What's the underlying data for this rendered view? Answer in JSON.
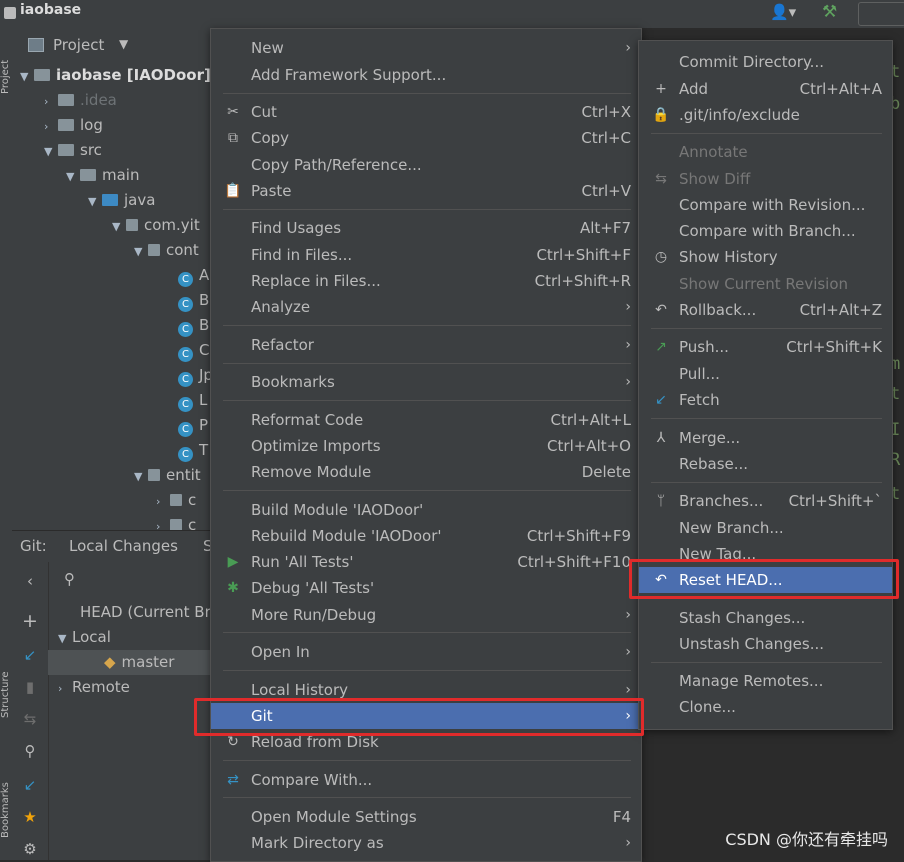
{
  "window": {
    "title": "iaobase"
  },
  "stripe": {
    "project_label": "Project",
    "structure_label": "Structure",
    "bookmarks_label": "Bookmarks"
  },
  "project_panel": {
    "header": "Project",
    "tree": [
      {
        "label": "iaobase [IAODoor]",
        "kind": "module"
      },
      {
        "label": ".idea",
        "kind": "folder"
      },
      {
        "label": "log",
        "kind": "folder"
      },
      {
        "label": "src",
        "kind": "folder"
      },
      {
        "label": "main",
        "kind": "folder"
      },
      {
        "label": "java",
        "kind": "folder-blue"
      },
      {
        "label": "com.yit",
        "kind": "package"
      },
      {
        "label": "cont",
        "kind": "package"
      },
      {
        "label": "A",
        "kind": "class"
      },
      {
        "label": "B",
        "kind": "class"
      },
      {
        "label": "B",
        "kind": "class"
      },
      {
        "label": "C",
        "kind": "class"
      },
      {
        "label": "Jp",
        "kind": "class"
      },
      {
        "label": "L",
        "kind": "class"
      },
      {
        "label": "P",
        "kind": "class"
      },
      {
        "label": "T",
        "kind": "class"
      },
      {
        "label": "entit",
        "kind": "package"
      },
      {
        "label": "c",
        "kind": "package"
      },
      {
        "label": "c",
        "kind": "package"
      }
    ]
  },
  "git_panel": {
    "tab_git": "Git:",
    "tab_local_changes": "Local Changes",
    "tab_more": "S",
    "branches": [
      {
        "label": "HEAD (Current Bra"
      },
      {
        "label": "Local"
      },
      {
        "label": "master"
      },
      {
        "label": "Remote"
      }
    ]
  },
  "context_menu": {
    "items": [
      {
        "label": "New"
      },
      {
        "label": "Add Framework Support..."
      },
      {
        "label": "Cut",
        "shortcut": "Ctrl+X"
      },
      {
        "label": "Copy",
        "shortcut": "Ctrl+C"
      },
      {
        "label": "Copy Path/Reference..."
      },
      {
        "label": "Paste",
        "shortcut": "Ctrl+V"
      },
      {
        "label": "Find Usages",
        "shortcut": "Alt+F7"
      },
      {
        "label": "Find in Files...",
        "shortcut": "Ctrl+Shift+F"
      },
      {
        "label": "Replace in Files...",
        "shortcut": "Ctrl+Shift+R"
      },
      {
        "label": "Analyze"
      },
      {
        "label": "Refactor"
      },
      {
        "label": "Bookmarks"
      },
      {
        "label": "Reformat Code",
        "shortcut": "Ctrl+Alt+L"
      },
      {
        "label": "Optimize Imports",
        "shortcut": "Ctrl+Alt+O"
      },
      {
        "label": "Remove Module",
        "shortcut": "Delete"
      },
      {
        "label": "Build Module 'IAODoor'"
      },
      {
        "label": "Rebuild Module 'IAODoor'",
        "shortcut": "Ctrl+Shift+F9"
      },
      {
        "label": "Run 'All Tests'",
        "shortcut": "Ctrl+Shift+F10"
      },
      {
        "label": "Debug 'All Tests'"
      },
      {
        "label": "More Run/Debug"
      },
      {
        "label": "Open In"
      },
      {
        "label": "Local History"
      },
      {
        "label": "Git"
      },
      {
        "label": "Reload from Disk"
      },
      {
        "label": "Compare With..."
      },
      {
        "label": "Open Module Settings",
        "shortcut": "F4"
      },
      {
        "label": "Mark Directory as"
      }
    ]
  },
  "git_submenu": {
    "items": [
      {
        "label": "Commit Directory..."
      },
      {
        "label": "Add",
        "shortcut": "Ctrl+Alt+A"
      },
      {
        "label": ".git/info/exclude"
      },
      {
        "label": "Annotate"
      },
      {
        "label": "Show Diff"
      },
      {
        "label": "Compare with Revision..."
      },
      {
        "label": "Compare with Branch..."
      },
      {
        "label": "Show History"
      },
      {
        "label": "Show Current Revision"
      },
      {
        "label": "Rollback...",
        "shortcut": "Ctrl+Alt+Z"
      },
      {
        "label": "Push...",
        "shortcut": "Ctrl+Shift+K"
      },
      {
        "label": "Pull..."
      },
      {
        "label": "Fetch"
      },
      {
        "label": "Merge..."
      },
      {
        "label": "Rebase..."
      },
      {
        "label": "Branches...",
        "shortcut": "Ctrl+Shift+`"
      },
      {
        "label": "New Branch..."
      },
      {
        "label": "New Tag..."
      },
      {
        "label": "Reset HEAD..."
      },
      {
        "label": "Stash Changes..."
      },
      {
        "label": "Unstash Changes..."
      },
      {
        "label": "Manage Remotes..."
      },
      {
        "label": "Clone..."
      }
    ]
  },
  "editor_fragments": [
    "t",
    "b",
    "m",
    "t",
    "I",
    "R",
    "t"
  ],
  "watermark": "CSDN @你还有牵挂吗",
  "colors": {
    "selection": "#4b6eaf",
    "highlight_box": "#e02b2b",
    "menu_bg": "#3c3f41"
  }
}
